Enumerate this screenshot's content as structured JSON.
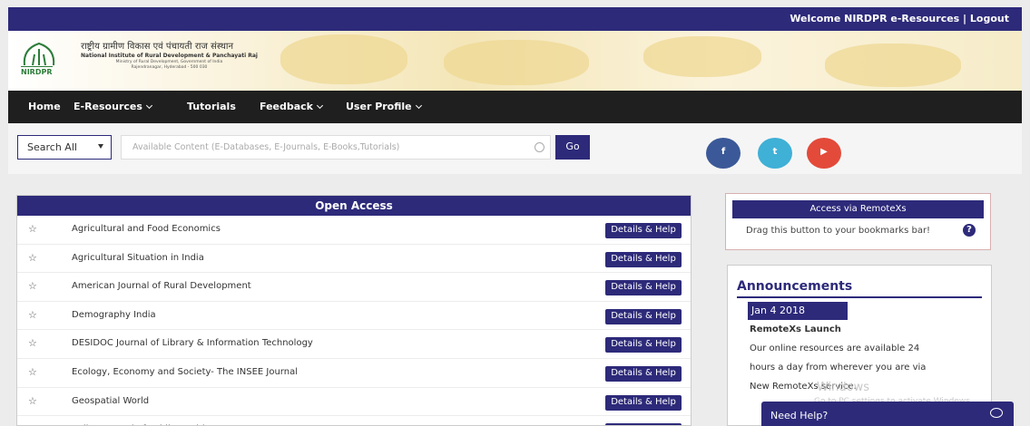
{
  "topbar": {
    "welcome": "Welcome  NIRDPR e-Resources | Logout"
  },
  "header": {
    "logo_text": "NIRDPR",
    "hindi_name": "राष्ट्रीय ग्रामीण विकास एवं पंचायती राज संस्थान",
    "english_name": "National Institute of Rural Development & Panchayati Raj",
    "ministry": "Ministry of Rural Development, Government of India",
    "address": "Rajendranagar, Hyderabad - 500 030"
  },
  "nav": {
    "home": "Home",
    "eresources": "E-Resources",
    "tutorials": "Tutorials",
    "feedback": "Feedback",
    "profile": "User Profile"
  },
  "search": {
    "scope": "Search All",
    "placeholder": "Available Content (E-Databases, E-Journals, E-Books,Tutorials)",
    "go": "Go"
  },
  "social": {
    "facebook": "f",
    "twitter": "t",
    "youtube": "▶"
  },
  "colors": {
    "primary": "#2d2a7a",
    "nav": "#1f1f1f",
    "facebook": "#3b5998",
    "twitter": "#3fb0d6",
    "youtube": "#e34a3a"
  },
  "open_access": {
    "title": "Open Access",
    "details_label": "Details & Help",
    "items": [
      "Agricultural and Food Economics",
      "Agricultural Situation in India",
      "American Journal of Rural Development",
      "Demography India",
      "DESIDOC Journal of Library & Information Technology",
      "Ecology, Economy and Society- The INSEE Journal",
      "Geospatial World",
      "Indian Journal of Public Health"
    ]
  },
  "remotexs": {
    "title": "Access via RemoteXs",
    "text": "Drag this button to your bookmarks bar!",
    "help": "?"
  },
  "announcements": {
    "title": "Announcements",
    "date": "Jan 4 2018",
    "headline": "RemoteXs Launch",
    "line1": "Our online resources are available 24",
    "line2": "hours a day from wherever you are via",
    "line3": "New RemoteXs service."
  },
  "watermark": {
    "line1": "Windows",
    "line2": "Go to PC settings to activate Windows."
  },
  "help_widget": {
    "label": "Need Help?"
  }
}
